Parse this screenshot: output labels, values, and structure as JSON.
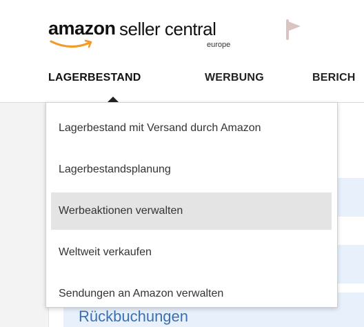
{
  "header": {
    "logo": {
      "amazon": "amazon",
      "seller_central": "seller central",
      "region": "europe"
    },
    "flag_icon": "flag-icon",
    "nav": {
      "tabs": [
        "LAGERBESTAND",
        "WERBUNG",
        "BERICH"
      ],
      "active_tab": "LAGERBESTAND"
    }
  },
  "dropdown": {
    "items": [
      "Lagerbestand mit Versand durch Amazon",
      "Lagerbestandsplanung",
      "Werbeaktionen verwalten",
      "Weltweit verkaufen",
      "Sendungen an Amazon verwalten"
    ],
    "highlighted_item": "Werbeaktionen verwalten"
  },
  "background": {
    "partial_link": "Rückbuchungen"
  },
  "colors": {
    "header_bg": "#ffffff",
    "page_bg": "#f6f6f6",
    "text": "#222222",
    "smile_orange": "#f29b2b",
    "flag_gray": "#d9c3c3",
    "highlight_bg": "#e4e4e4",
    "link_blue": "#3b6fb0"
  }
}
